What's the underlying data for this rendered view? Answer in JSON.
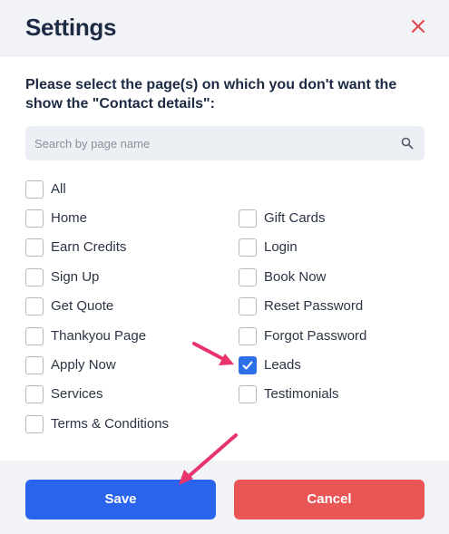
{
  "header": {
    "title": "Settings"
  },
  "prompt": "Please select the page(s) on which you don't want the show the \"Contact details\":",
  "search": {
    "placeholder": "Search by page name",
    "value": ""
  },
  "options": [
    {
      "label": "All",
      "checked": false
    },
    {
      "label": "Home",
      "checked": false
    },
    {
      "label": "Gift Cards",
      "checked": false
    },
    {
      "label": "Earn Credits",
      "checked": false
    },
    {
      "label": "Login",
      "checked": false
    },
    {
      "label": "Sign Up",
      "checked": false
    },
    {
      "label": "Book Now",
      "checked": false
    },
    {
      "label": "Get Quote",
      "checked": false
    },
    {
      "label": "Reset Password",
      "checked": false
    },
    {
      "label": "Thankyou Page",
      "checked": false
    },
    {
      "label": "Forgot Password",
      "checked": false
    },
    {
      "label": "Apply Now",
      "checked": false
    },
    {
      "label": "Leads",
      "checked": true
    },
    {
      "label": "Services",
      "checked": false
    },
    {
      "label": "Testimonials",
      "checked": false
    },
    {
      "label": "Terms & Conditions",
      "checked": false
    }
  ],
  "footer": {
    "save_label": "Save",
    "cancel_label": "Cancel"
  },
  "colors": {
    "accent": "#2b64ec",
    "danger": "#ea5656",
    "close": "#e0474c",
    "annotation_arrow": "#e8336d"
  },
  "icons": {
    "close": "close-icon",
    "search": "search-icon",
    "check": "check-icon",
    "annotation": "arrow-icon"
  }
}
